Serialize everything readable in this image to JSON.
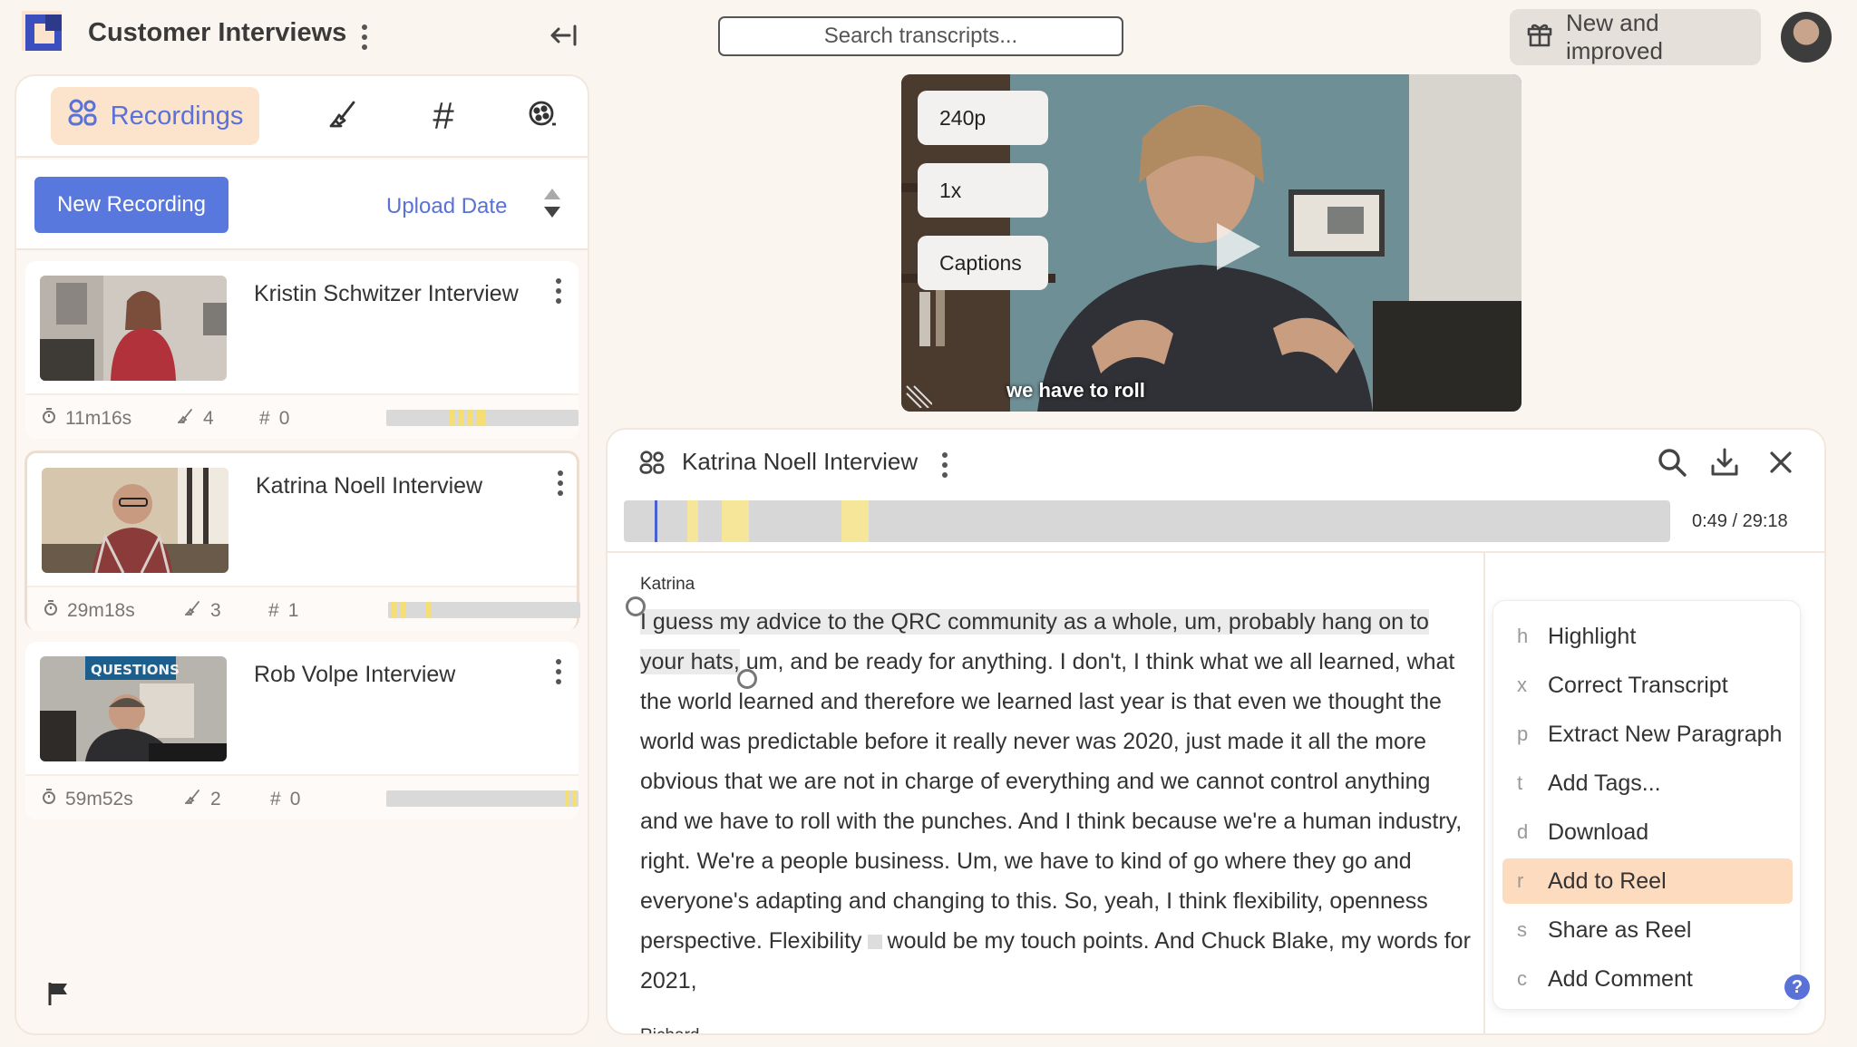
{
  "app": {
    "title": "Customer Interviews"
  },
  "header": {
    "search_placeholder": "Search transcripts...",
    "new_improved_label": "New and improved"
  },
  "left_panel": {
    "tabs": [
      {
        "label": "Recordings",
        "icon": "users-icon"
      },
      {
        "label": "",
        "icon": "highlighter-icon"
      },
      {
        "label": "#",
        "icon": "hashtag-icon"
      },
      {
        "label": "",
        "icon": "reel-icon"
      }
    ],
    "new_recording_label": "New Recording",
    "sort_label": "Upload Date",
    "recordings": [
      {
        "title": "Kristin Schwitzer Interview",
        "duration": "11m16s",
        "highlights": "4",
        "tags": "0"
      },
      {
        "title": "Katrina Noell Interview",
        "duration": "29m18s",
        "highlights": "3",
        "tags": "1"
      },
      {
        "title": "Rob Volpe Interview",
        "duration": "59m52s",
        "highlights": "2",
        "tags": "0"
      }
    ]
  },
  "video": {
    "quality": "240p",
    "speed": "1x",
    "captions_label": "Captions",
    "caption_text": "we have to roll"
  },
  "transcript": {
    "title": "Katrina Noell Interview",
    "time": "0:49 / 29:18",
    "speaker_1": "Katrina",
    "text_highlighted": "I guess my advice to the QRC community as a whole, um, probably hang on to your hats,",
    "text_main": " um, and be ready for anything. I don't, I think what we all learned, what the world learned and therefore we learned last year is that even we thought the world was predictable before it really never was 2020, just made it all the more obvious that we are not in charge of everything and we cannot control anything and we have to roll with the punches. And I think because we're a human industry, right. We're a people business. Um, we have to kind of go where they go and everyone's adapting and changing to this. So, yeah, I think flexibility, openness perspective. Flexibility",
    "text_after": "would be my touch points. And Chuck Blake, my words for 2021,",
    "speaker_2": "Richard"
  },
  "context_menu": {
    "items": [
      {
        "key": "h",
        "label": "Highlight"
      },
      {
        "key": "x",
        "label": "Correct Transcript"
      },
      {
        "key": "p",
        "label": "Extract New Paragraph"
      },
      {
        "key": "t",
        "label": "Add Tags..."
      },
      {
        "key": "d",
        "label": "Download"
      },
      {
        "key": "r",
        "label": "Add to Reel"
      },
      {
        "key": "s",
        "label": "Share as Reel"
      },
      {
        "key": "c",
        "label": "Add Comment"
      }
    ],
    "active_item": "Add to Reel"
  },
  "help_label": "?",
  "colors": {
    "accent": "#5878de",
    "background": "#fbf5ef",
    "active_tab": "#fbe3cc",
    "highlight_marker": "#f5df74",
    "menu_active": "#fddbbf"
  }
}
